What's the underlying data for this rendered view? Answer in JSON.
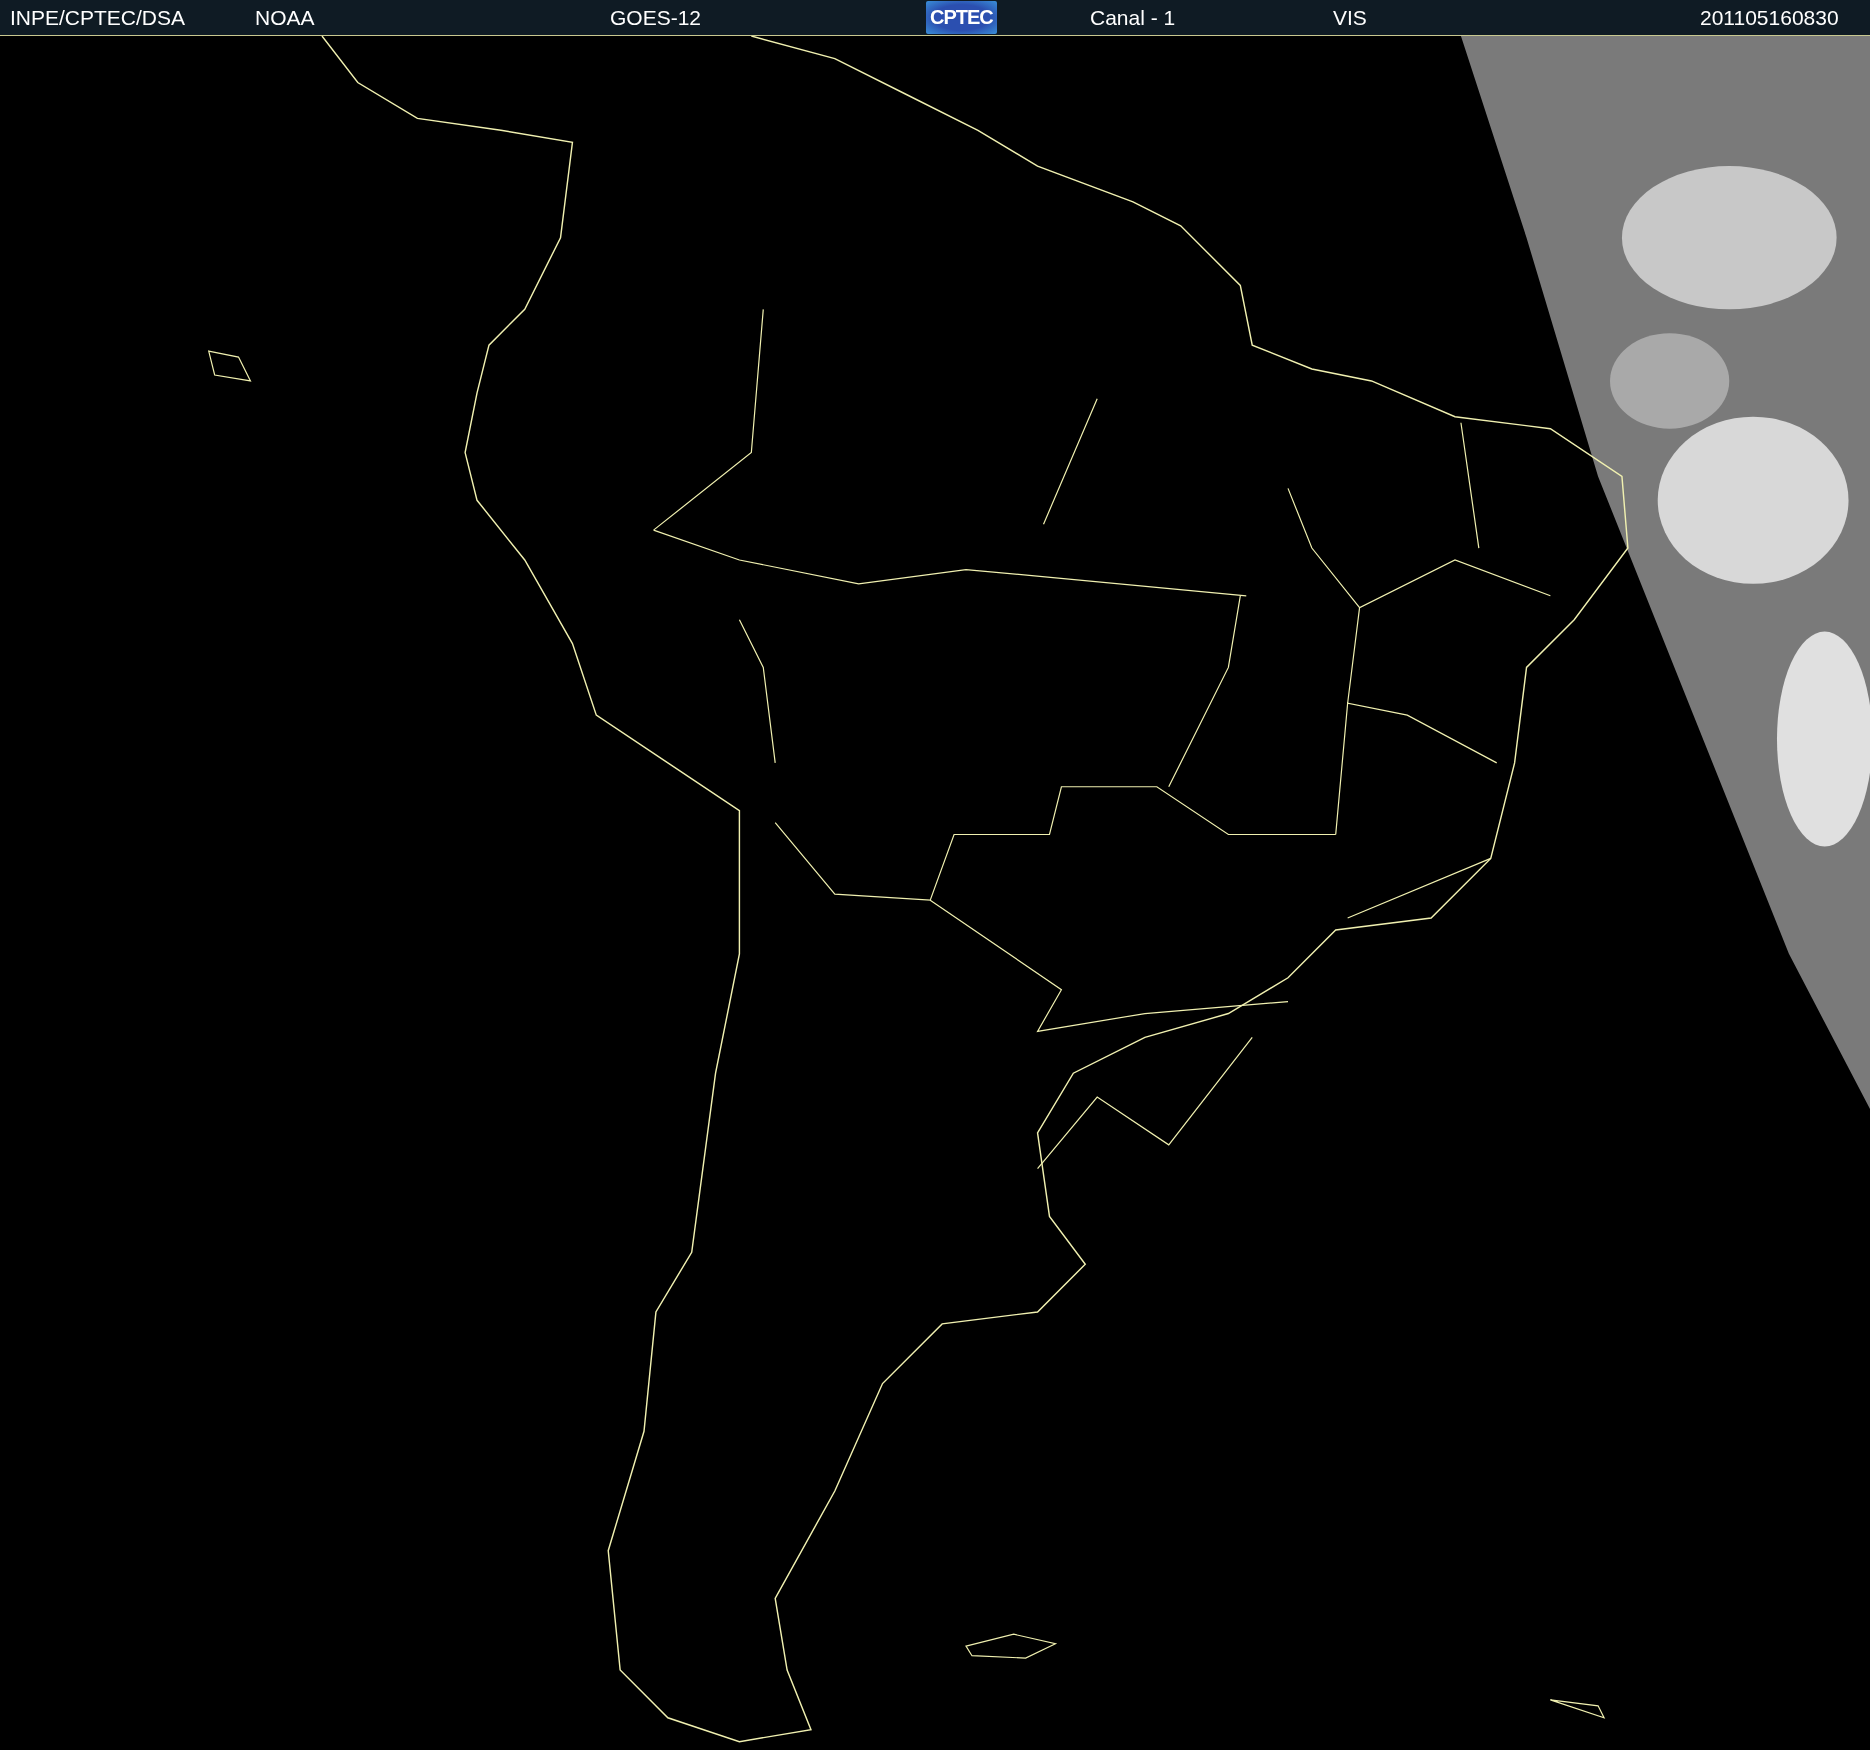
{
  "header": {
    "source": "INPE/CPTEC/DSA",
    "agency": "NOAA",
    "satellite": "GOES-12",
    "logo": "CPTEC",
    "channel": "Canal - 1",
    "band": "VIS",
    "timestamp": "201105160830"
  }
}
